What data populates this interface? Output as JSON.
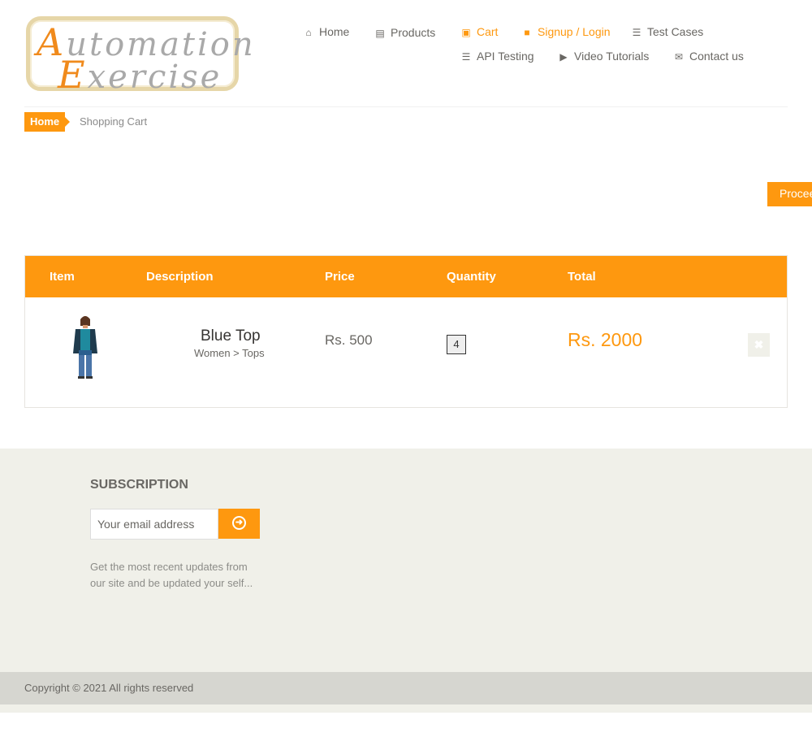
{
  "logo": {
    "line1_cap": "A",
    "line1_rest": "utomation",
    "line2_cap": "E",
    "line2_rest": "xercise"
  },
  "nav": {
    "items": [
      {
        "label": "Home",
        "icon": "home-icon"
      },
      {
        "label": "Products",
        "icon": "products-icon"
      },
      {
        "label": "Cart",
        "icon": "cart-icon",
        "active": true
      },
      {
        "label": "Signup / Login",
        "icon": "lock-icon",
        "active": true
      },
      {
        "label": "Test Cases",
        "icon": "list-icon"
      },
      {
        "label": "API Testing",
        "icon": "list-icon"
      },
      {
        "label": "Video Tutorials",
        "icon": "youtube-icon"
      },
      {
        "label": "Contact us",
        "icon": "envelope-icon"
      }
    ]
  },
  "breadcrumb": {
    "home": "Home",
    "current": "Shopping Cart"
  },
  "proceed_label": "Procee",
  "cart": {
    "headers": {
      "item": "Item",
      "description": "Description",
      "price": "Price",
      "quantity": "Quantity",
      "total": "Total"
    },
    "rows": [
      {
        "name": "Blue Top",
        "category": "Women > Tops",
        "price": "Rs. 500",
        "quantity": "4",
        "total": "Rs. 2000"
      }
    ]
  },
  "footer": {
    "subscription_title": "SUBSCRIPTION",
    "email_placeholder": "Your email address",
    "note": "Get the most recent updates from our site and be updated your self...",
    "copyright": "Copyright © 2021 All rights reserved"
  },
  "colors": {
    "accent": "#fe980f",
    "footer_bg": "#f0f0e9",
    "copyright_bg": "#d6d6d0"
  }
}
